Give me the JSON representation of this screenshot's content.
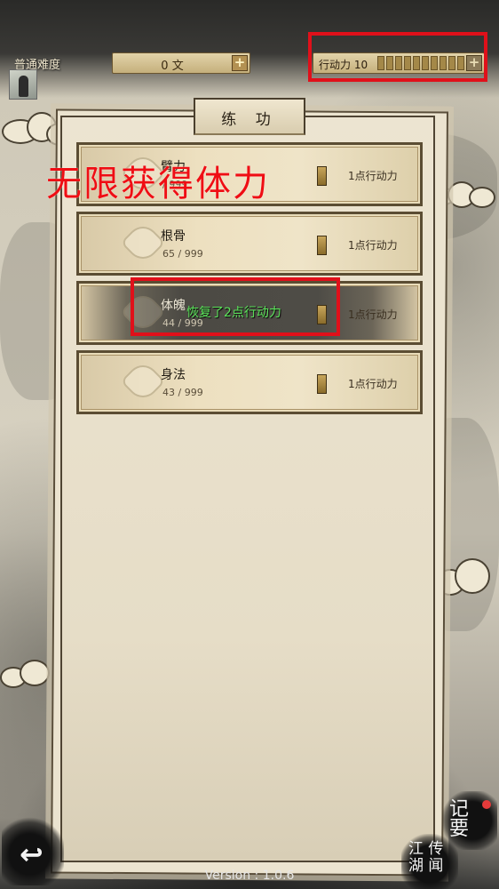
{
  "header": {
    "difficulty": "普通难度",
    "coins": "0 文",
    "action_points_label": "行动力 10",
    "action_points_filled": 10
  },
  "panel": {
    "title": "练 功"
  },
  "banner": "无限获得体力",
  "cards": [
    {
      "name": "臂力",
      "value": "/ 999",
      "cost": "1点行动力"
    },
    {
      "name": "根骨",
      "value": "65 / 999",
      "cost": "1点行动力"
    },
    {
      "name": "体魄",
      "value": "44 / 999",
      "cost": "1点行动力"
    },
    {
      "name": "身法",
      "value": "43 / 999",
      "cost": "1点行动力"
    }
  ],
  "toast": "恢复了2点行动力",
  "buttons": {
    "back": "↩",
    "jiyao": "记 要",
    "jianghu": "江 传 湖 闻"
  },
  "version": "Version : 1.0.6",
  "colors": {
    "annotation_red": "#e0101a",
    "toast_green": "#5be35a"
  }
}
